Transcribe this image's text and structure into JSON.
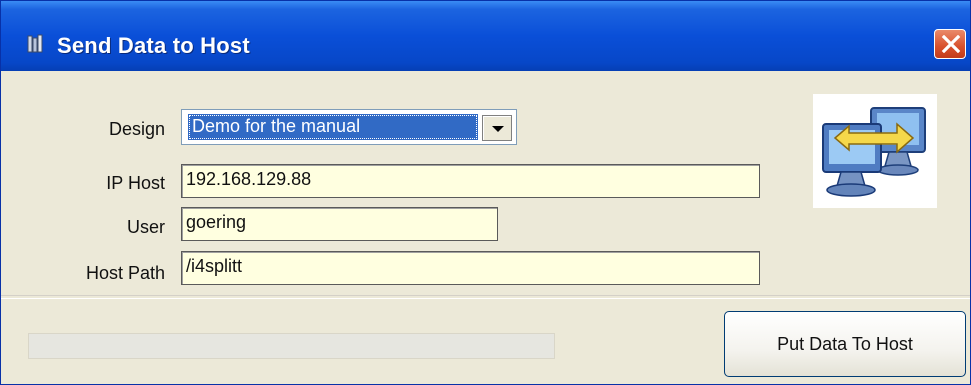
{
  "window": {
    "title": "Send Data to Host",
    "icon": "app-icon",
    "close_icon": "close-icon"
  },
  "form": {
    "design_label": "Design",
    "design_value": "Demo for the manual",
    "ip_host_label": "IP Host",
    "ip_host_value": "192.168.129.88",
    "user_label": "User",
    "user_value": "goering",
    "host_path_label": "Host Path",
    "host_path_value": "/i4splitt"
  },
  "logo": {
    "icon": "network-transfer-icon"
  },
  "footer": {
    "progress_percent": 0,
    "put_button_label": "Put Data To Host"
  },
  "colors": {
    "titlebar": "#0a4fd8",
    "field_background": "#ffffe0",
    "selection": "#316ac5",
    "close_button": "#d8502c",
    "window_background": "#ece9d8"
  }
}
